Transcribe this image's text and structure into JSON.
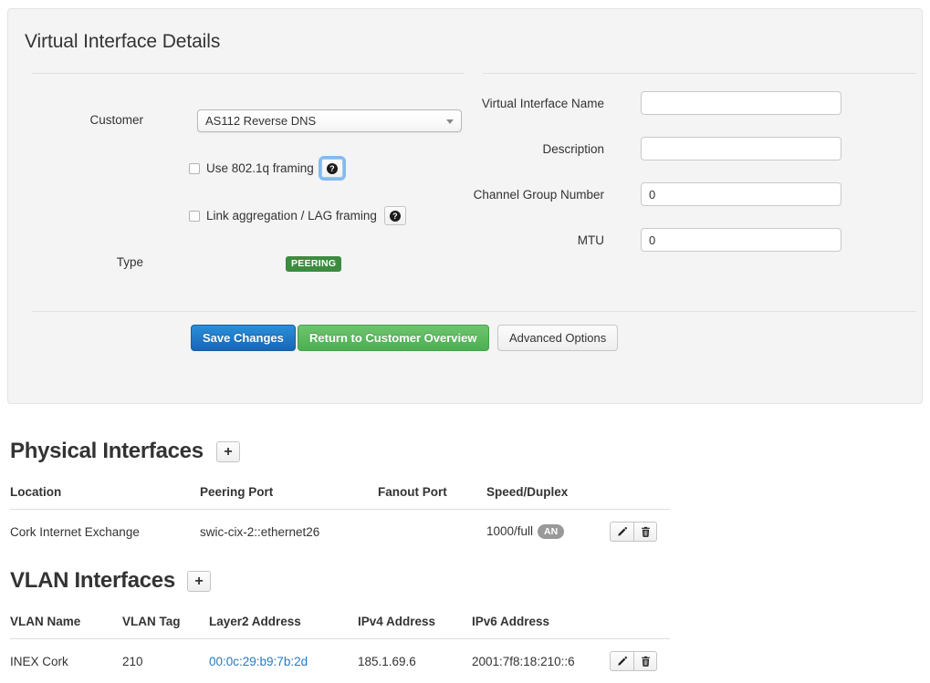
{
  "panel": {
    "title": "Virtual Interface Details",
    "customer": {
      "label": "Customer",
      "selected": "AS112 Reverse DNS"
    },
    "checkboxes": [
      {
        "label": "Use 802.1q framing",
        "checked": false,
        "help": "?",
        "focused": true
      },
      {
        "label": "Link aggregation / LAG framing",
        "checked": false,
        "help": "?",
        "focused": false
      }
    ],
    "type": {
      "label": "Type",
      "badge": "PEERING",
      "badge_color": "#3c8c40"
    },
    "fields": [
      {
        "label": "Virtual Interface Name",
        "value": ""
      },
      {
        "label": "Description",
        "value": ""
      },
      {
        "label": "Channel Group Number",
        "value": "0"
      },
      {
        "label": "MTU",
        "value": "0"
      }
    ],
    "actions": [
      {
        "label": "Save Changes",
        "style": "primary"
      },
      {
        "label": "Return to Customer Overview",
        "style": "success"
      },
      {
        "label": "Advanced Options",
        "style": "default"
      }
    ]
  },
  "physical_interfaces": {
    "heading": "Physical Interfaces",
    "add_label": "+",
    "columns": [
      "Location",
      "Peering Port",
      "Fanout Port",
      "Speed/Duplex",
      ""
    ],
    "rows": [
      {
        "location": "Cork Internet Exchange",
        "peering_port": "swic-cix-2::ethernet26",
        "fanout_port": "",
        "speed_duplex": "1000/full",
        "autoneg_badge": "AN"
      }
    ]
  },
  "vlan_interfaces": {
    "heading": "VLAN Interfaces",
    "add_label": "+",
    "columns": [
      "VLAN Name",
      "VLAN Tag",
      "Layer2 Address",
      "IPv4 Address",
      "IPv6 Address",
      ""
    ],
    "rows": [
      {
        "vlan_name": "INEX Cork",
        "vlan_tag": "210",
        "layer2_address": "00:0c:29:b9:7b:2d",
        "ipv4_address": "185.1.69.6",
        "ipv6_address": "2001:7f8:18:210::6"
      }
    ]
  },
  "icons": {
    "edit": "pencil-icon",
    "delete": "trash-icon",
    "help": "question-mark-icon",
    "add": "plus-icon",
    "dropdown": "chevron-down-icon"
  },
  "colors": {
    "link": "#2779bd",
    "primary": "#1766b8",
    "success": "#4caf50",
    "badge_green": "#3c8c40",
    "badge_gray": "#999999"
  }
}
